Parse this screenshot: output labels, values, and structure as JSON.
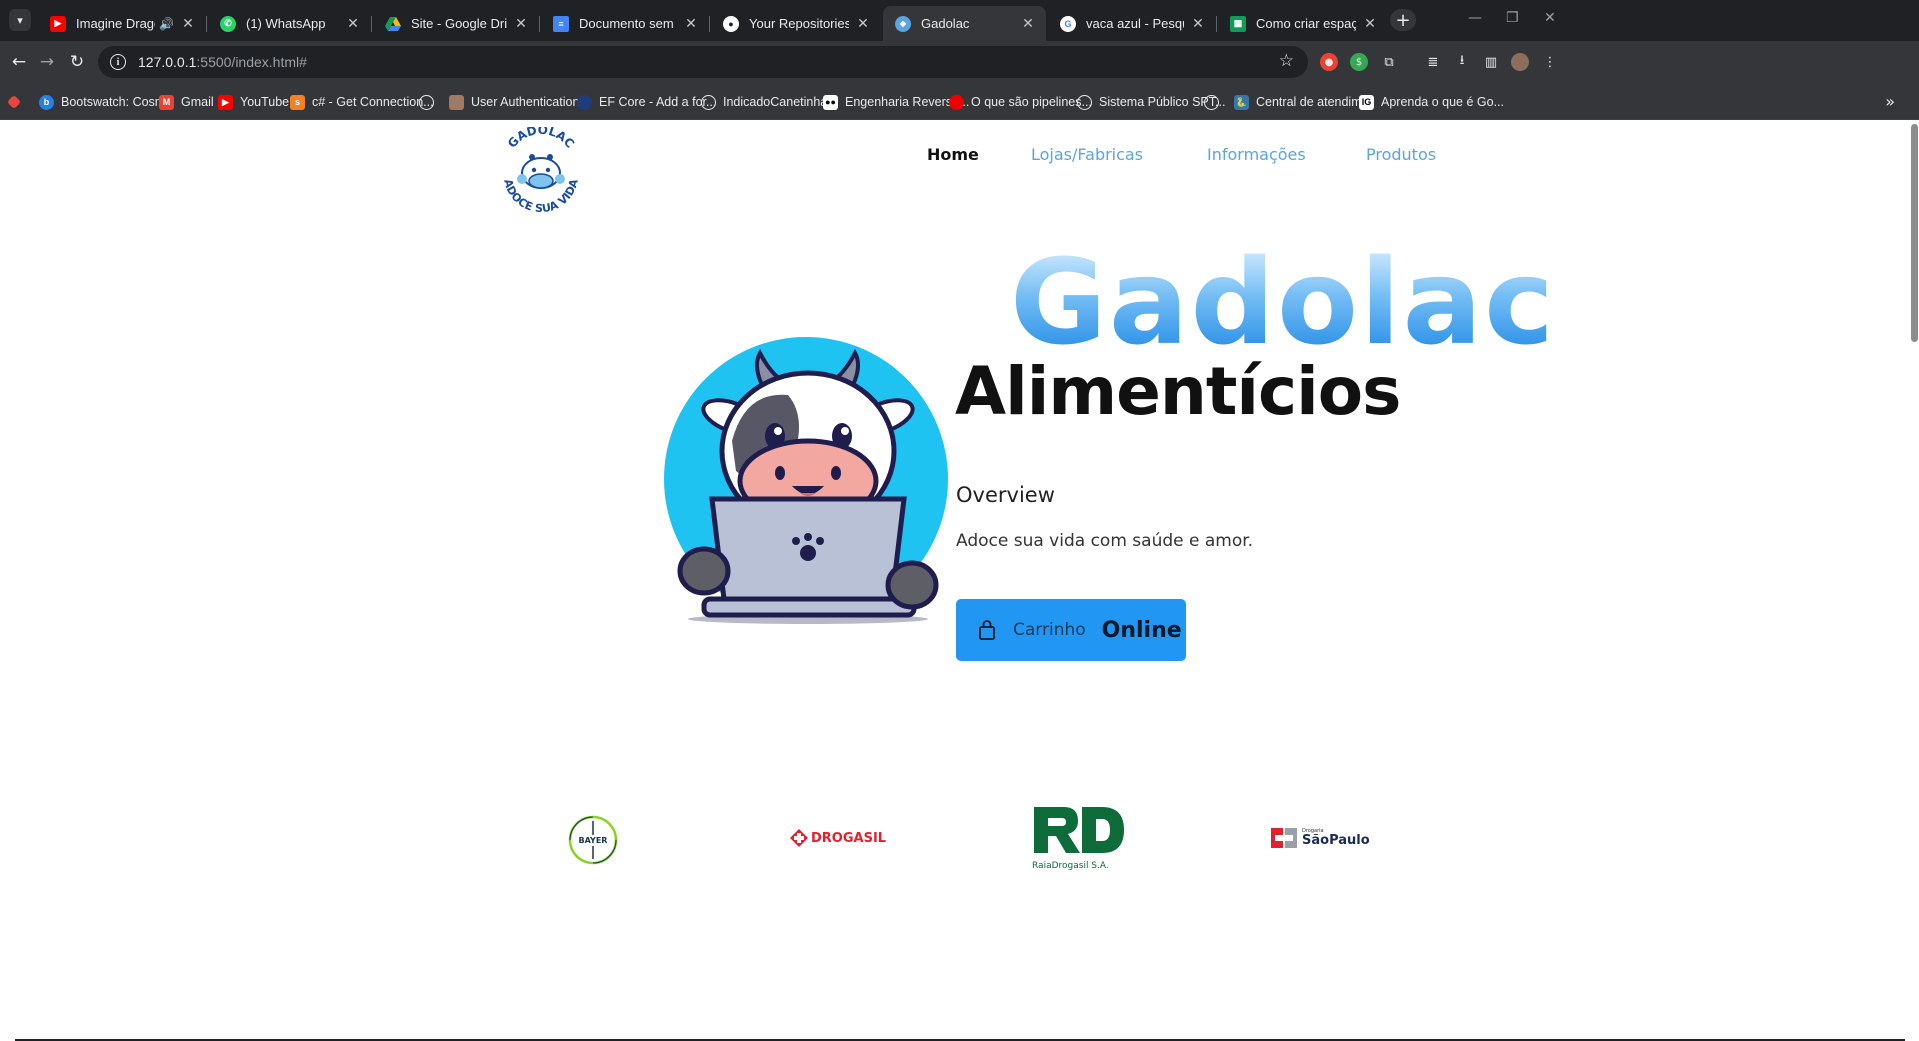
{
  "browser": {
    "tabs": [
      {
        "title": "Imagine Dragons - W",
        "icon": "youtube-icon",
        "color": "#ff0000"
      },
      {
        "title": "(1) WhatsApp",
        "icon": "whatsapp-icon",
        "color": "#25d366"
      },
      {
        "title": "Site - Google Drive",
        "icon": "google-drive-icon",
        "color": "#fbbc04"
      },
      {
        "title": "Documento sem título - D",
        "icon": "google-docs-icon",
        "color": "#4285f4"
      },
      {
        "title": "Your Repositories",
        "icon": "github-icon",
        "color": "#ffffff"
      },
      {
        "title": "Gadolac",
        "icon": "gadolac-favicon",
        "color": "#5aa4e0"
      },
      {
        "title": "vaca azul - Pesquisa Goo",
        "icon": "google-icon",
        "color": "#4285f4"
      },
      {
        "title": "Como criar espaço antes",
        "icon": "sheets-icon",
        "color": "#0f9d58"
      }
    ],
    "active_tab": "Gadolac",
    "url_host": "127.0.0.1",
    "url_path": ":5500/index.html#",
    "bookmarks": [
      {
        "label": "Bootswatch: Cosmo",
        "icon": "bootswatch-icon"
      },
      {
        "label": "Gmail",
        "icon": "gmail-icon"
      },
      {
        "label": "YouTube",
        "icon": "youtube-icon"
      },
      {
        "label": "c# - Get Connection...",
        "icon": "stackoverflow-icon"
      },
      {
        "label": "",
        "icon": "globe-icon"
      },
      {
        "label": "User Authentication...",
        "icon": "avatar-icon"
      },
      {
        "label": "EF Core - Add a for...",
        "icon": "globe-icon"
      },
      {
        "label": "IndicadoCanetinha...",
        "icon": "globe-icon"
      },
      {
        "label": "Engenharia Reversa...",
        "icon": "medium-icon"
      },
      {
        "label": "O que são pipelines...",
        "icon": "redhat-icon"
      },
      {
        "label": "Sistema Público SPT...",
        "icon": "globe-icon"
      },
      {
        "label": "",
        "icon": "globe-icon"
      },
      {
        "label": "Central de atendim...",
        "icon": "python-icon"
      },
      {
        "label": "Aprenda o que é Go...",
        "icon": "lg-icon"
      }
    ]
  },
  "site": {
    "nav": {
      "home": "Home",
      "stores": "Lojas/Fabricas",
      "info": "Informações",
      "products": "Produtos"
    },
    "logo_text_top": "GADOLAC",
    "logo_text_bottom": "ADOCE SUA VIDA",
    "hero_title": "Gadolac",
    "hero_subtitle": "Alimentícios",
    "overview_heading": "Overview",
    "tagline": "Adoce sua vida com saúde e amor.",
    "cart_button": {
      "label": "Carrinho",
      "emphasis": "Online"
    },
    "partners": [
      {
        "name": "BAYER"
      },
      {
        "name": "DROGASIL"
      },
      {
        "name": "RaiaDrogasil S.A."
      },
      {
        "name": "SãoPaulo",
        "prefix": "Drogaria"
      }
    ]
  }
}
